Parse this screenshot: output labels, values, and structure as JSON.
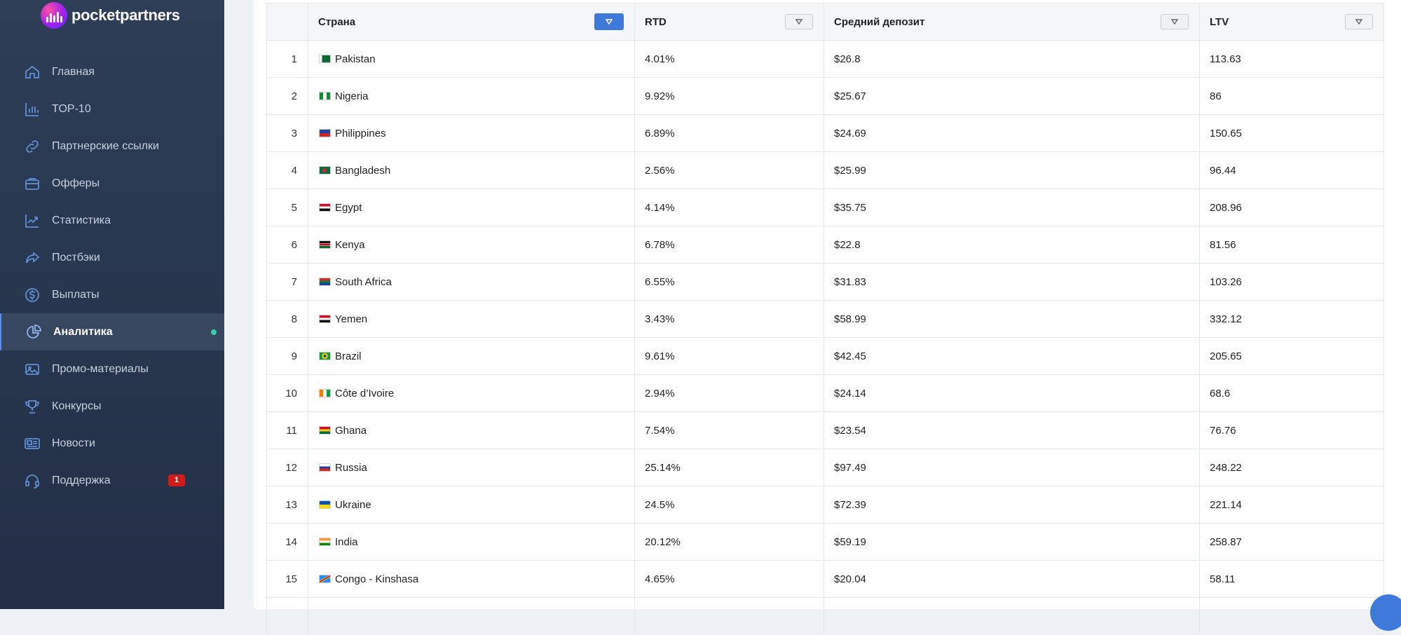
{
  "brand": {
    "name": "pocketpartners"
  },
  "colors": {
    "sidebar": "#283850",
    "accent": "#3f79d9",
    "active_dot": "#2ed3a4",
    "badge": "#d11b1b"
  },
  "sidebar": {
    "items": [
      {
        "label": "Главная",
        "icon": "home-icon"
      },
      {
        "label": "TOP-10",
        "icon": "bar-chart-icon"
      },
      {
        "label": "Партнерские ссылки",
        "icon": "link-icon"
      },
      {
        "label": "Офферы",
        "icon": "briefcase-icon"
      },
      {
        "label": "Статистика",
        "icon": "trend-icon"
      },
      {
        "label": "Постбэки",
        "icon": "share-arrow-icon"
      },
      {
        "label": "Выплаты",
        "icon": "dollar-icon"
      },
      {
        "label": "Аналитика",
        "icon": "pie-chart-icon",
        "active": true
      },
      {
        "label": "Промо-материалы",
        "icon": "image-icon"
      },
      {
        "label": "Конкурсы",
        "icon": "trophy-icon"
      },
      {
        "label": "Новости",
        "icon": "news-icon"
      },
      {
        "label": "Поддержка",
        "icon": "headset-icon",
        "badge": "1"
      }
    ]
  },
  "table": {
    "columns": {
      "country": "Страна",
      "rtd": "RTD",
      "avg_deposit": "Средний депозит",
      "ltv": "LTV"
    },
    "rows": [
      {
        "n": "1",
        "country": "Pakistan",
        "flag": "pk",
        "rtd": "4.01%",
        "avg_deposit": "$26.8",
        "ltv": "113.63"
      },
      {
        "n": "2",
        "country": "Nigeria",
        "flag": "ng",
        "rtd": "9.92%",
        "avg_deposit": "$25.67",
        "ltv": "86"
      },
      {
        "n": "3",
        "country": "Philippines",
        "flag": "ph",
        "rtd": "6.89%",
        "avg_deposit": "$24.69",
        "ltv": "150.65"
      },
      {
        "n": "4",
        "country": "Bangladesh",
        "flag": "bd",
        "rtd": "2.56%",
        "avg_deposit": "$25.99",
        "ltv": "96.44"
      },
      {
        "n": "5",
        "country": "Egypt",
        "flag": "eg",
        "rtd": "4.14%",
        "avg_deposit": "$35.75",
        "ltv": "208.96"
      },
      {
        "n": "6",
        "country": "Kenya",
        "flag": "ke",
        "rtd": "6.78%",
        "avg_deposit": "$22.8",
        "ltv": "81.56"
      },
      {
        "n": "7",
        "country": "South Africa",
        "flag": "za",
        "rtd": "6.55%",
        "avg_deposit": "$31.83",
        "ltv": "103.26"
      },
      {
        "n": "8",
        "country": "Yemen",
        "flag": "ye",
        "rtd": "3.43%",
        "avg_deposit": "$58.99",
        "ltv": "332.12"
      },
      {
        "n": "9",
        "country": "Brazil",
        "flag": "br",
        "rtd": "9.61%",
        "avg_deposit": "$42.45",
        "ltv": "205.65"
      },
      {
        "n": "10",
        "country": "Côte d’Ivoire",
        "flag": "ci",
        "rtd": "2.94%",
        "avg_deposit": "$24.14",
        "ltv": "68.6"
      },
      {
        "n": "11",
        "country": "Ghana",
        "flag": "gh",
        "rtd": "7.54%",
        "avg_deposit": "$23.54",
        "ltv": "76.76"
      },
      {
        "n": "12",
        "country": "Russia",
        "flag": "ru",
        "rtd": "25.14%",
        "avg_deposit": "$97.49",
        "ltv": "248.22"
      },
      {
        "n": "13",
        "country": "Ukraine",
        "flag": "ua",
        "rtd": "24.5%",
        "avg_deposit": "$72.39",
        "ltv": "221.14"
      },
      {
        "n": "14",
        "country": "India",
        "flag": "in",
        "rtd": "20.12%",
        "avg_deposit": "$59.19",
        "ltv": "258.87"
      },
      {
        "n": "15",
        "country": "Congo - Kinshasa",
        "flag": "cd",
        "rtd": "4.65%",
        "avg_deposit": "$20.04",
        "ltv": "58.11"
      }
    ]
  }
}
